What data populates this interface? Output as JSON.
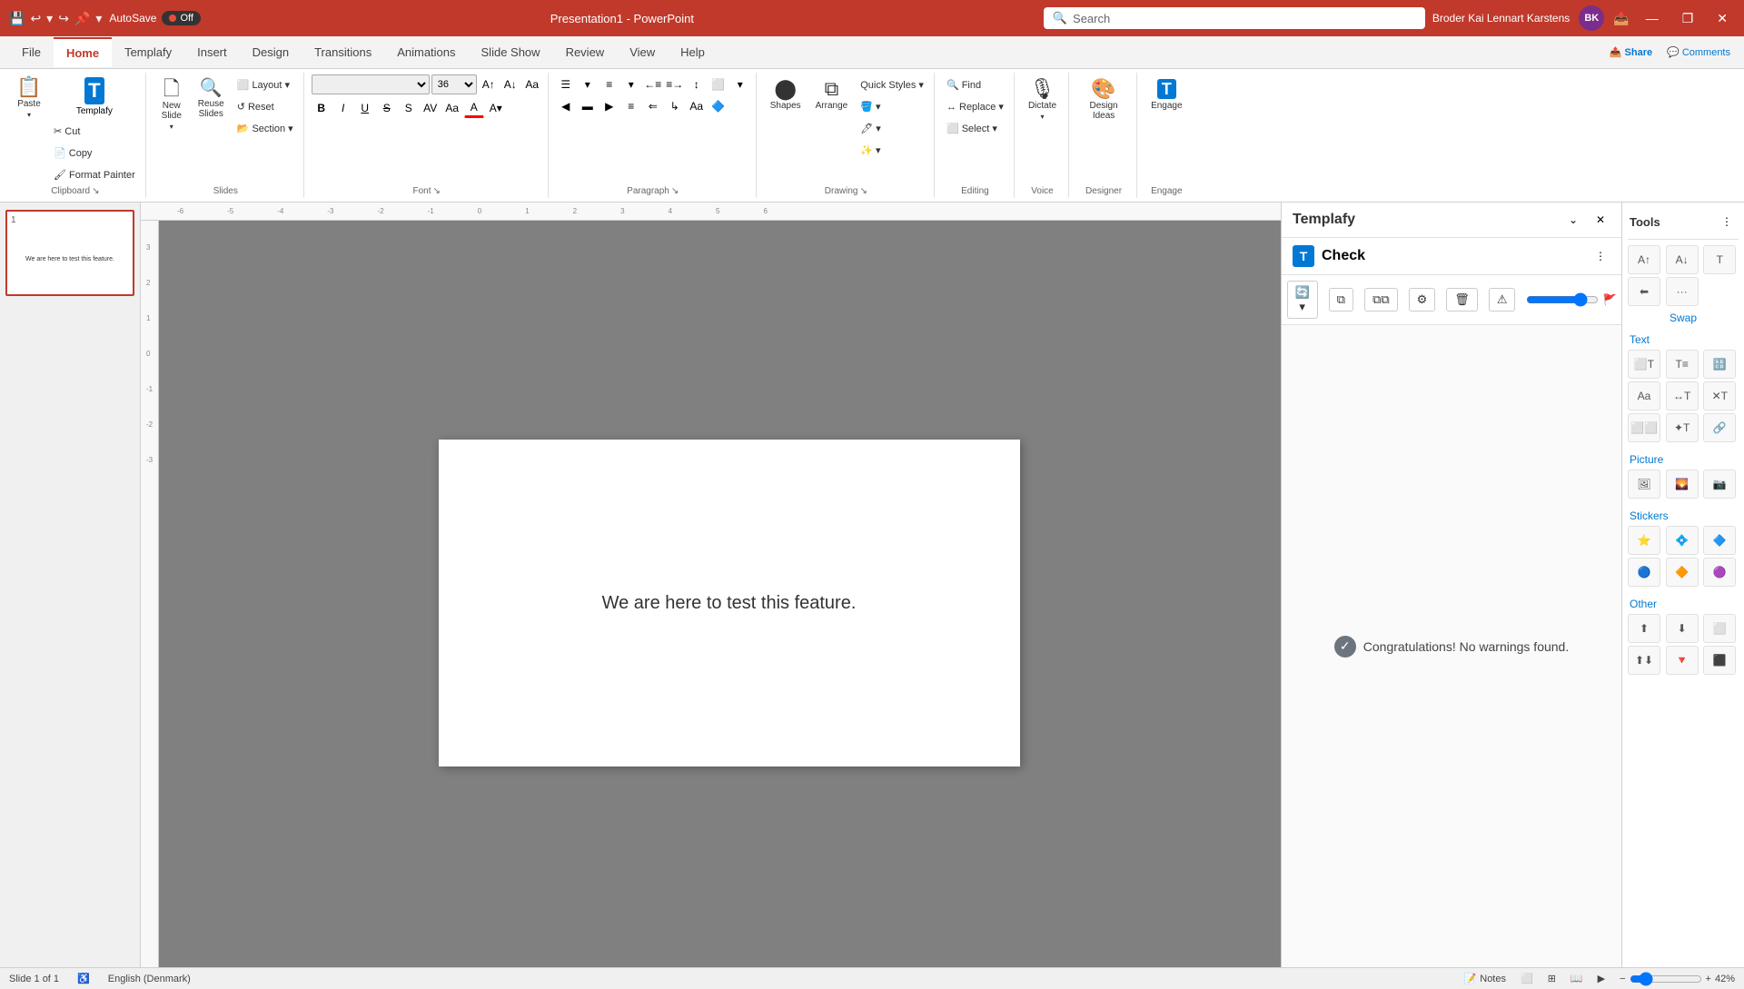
{
  "titlebar": {
    "autosave_label": "AutoSave",
    "toggle_label": "Off",
    "title": "Presentation1  -  PowerPoint",
    "search_placeholder": "Search",
    "user_name": "Broder Kai Lennart Karstens",
    "user_initials": "BK",
    "window_controls": [
      "minimize",
      "restore",
      "close"
    ]
  },
  "ribbon": {
    "tabs": [
      "File",
      "Home",
      "Templafy",
      "Insert",
      "Design",
      "Transitions",
      "Animations",
      "Slide Show",
      "Review",
      "View",
      "Help"
    ],
    "active_tab": "Home",
    "groups": {
      "clipboard": {
        "label": "Clipboard",
        "items": [
          "Paste",
          "Templafy",
          "Cut",
          "Copy",
          "Format Painter"
        ]
      },
      "slides": {
        "label": "Slides",
        "items": [
          "New Slide",
          "Reuse Slides",
          "Layout",
          "Reset",
          "Section"
        ]
      },
      "font": {
        "label": "Font",
        "font_name": "",
        "font_size": "36",
        "bold": "B",
        "italic": "I",
        "underline": "U",
        "strikethrough": "S",
        "shadow": "s",
        "char_spacing": "AV",
        "font_color": "A",
        "highlight": "A"
      },
      "paragraph": {
        "label": "Paragraph"
      },
      "drawing": {
        "label": "Drawing",
        "items": [
          "Shapes",
          "Arrange",
          "Quick Styles"
        ]
      },
      "editing": {
        "label": "Editing",
        "items": [
          "Find",
          "Replace",
          "Select"
        ]
      },
      "voice": {
        "label": "Voice",
        "items": [
          "Dictate"
        ]
      },
      "designer": {
        "label": "Designer",
        "items": [
          "Design Ideas"
        ]
      },
      "engage": {
        "label": "Engage",
        "items": [
          "Engage"
        ]
      }
    }
  },
  "slide_panel": {
    "slide_number": "1",
    "slide_text": "We are here to test this feature."
  },
  "canvas": {
    "slide_text": "We are here to test this feature."
  },
  "templafy": {
    "panel_title": "Templafy",
    "check_title": "Check",
    "success_message": "Congratulations! No warnings found.",
    "tools_title": "Tools",
    "swap_label": "Swap",
    "text_label": "Text",
    "picture_label": "Picture",
    "stickers_label": "Stickers",
    "other_label": "Other"
  },
  "statusbar": {
    "slide_info": "Slide 1 of 1",
    "language": "English (Denmark)",
    "notes_label": "Notes",
    "zoom_level": "42%",
    "view_icons": [
      "normal",
      "slide-sorter",
      "reading",
      "slideshow"
    ]
  }
}
